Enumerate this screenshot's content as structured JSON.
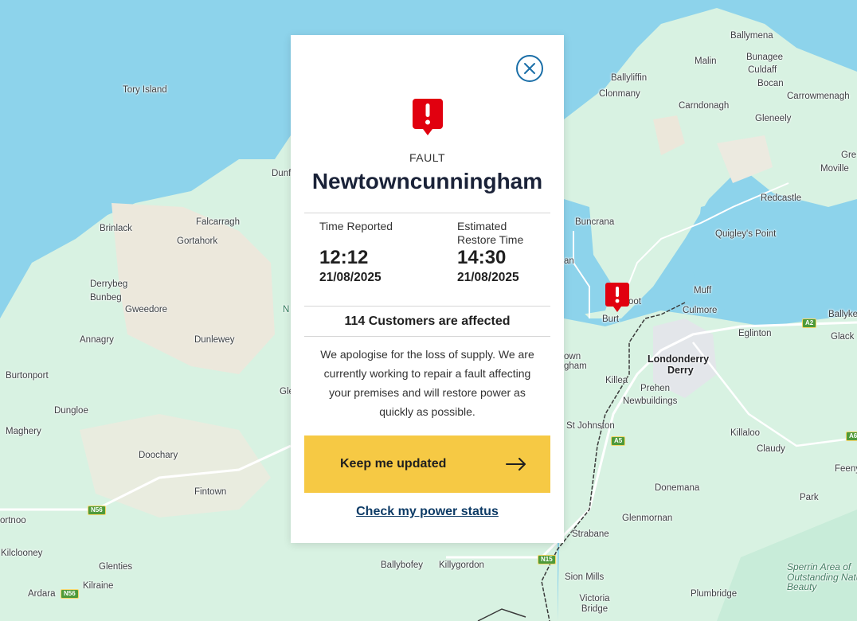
{
  "map": {
    "places": [
      {
        "id": "ballymena",
        "label": "Ballymena"
      },
      {
        "id": "malin",
        "label": "Malin"
      },
      {
        "id": "bunagee",
        "label": "Bunagee"
      },
      {
        "id": "culdaff",
        "label": "Culdaff"
      },
      {
        "id": "ballyliffin",
        "label": "Ballyliffin"
      },
      {
        "id": "bocan",
        "label": "Bocan"
      },
      {
        "id": "clonmany",
        "label": "Clonmany"
      },
      {
        "id": "carrowmenagh",
        "label": "Carrowmenagh"
      },
      {
        "id": "tory-island",
        "label": "Tory Island"
      },
      {
        "id": "carndonagh",
        "label": "Carndonagh"
      },
      {
        "id": "gleneely",
        "label": "Gleneely"
      },
      {
        "id": "gre",
        "label": "Gre"
      },
      {
        "id": "moville",
        "label": "Moville"
      },
      {
        "id": "dunf",
        "label": "Dunf"
      },
      {
        "id": "redcastle",
        "label": "Redcastle"
      },
      {
        "id": "falcarragh",
        "label": "Falcarragh"
      },
      {
        "id": "buncrana",
        "label": "Buncrana"
      },
      {
        "id": "brinlack",
        "label": "Brinlack"
      },
      {
        "id": "gortahork",
        "label": "Gortahork"
      },
      {
        "id": "quigleys-point",
        "label": "Quigley's Point"
      },
      {
        "id": "an",
        "label": "an"
      },
      {
        "id": "derrybeg",
        "label": "Derrybeg"
      },
      {
        "id": "bunbeg",
        "label": "Bunbeg"
      },
      {
        "id": "muff",
        "label": "Muff"
      },
      {
        "id": "gweedore",
        "label": "Gweedore"
      },
      {
        "id": "n-partial",
        "label": "N"
      },
      {
        "id": "burnfoot",
        "label": "oot"
      },
      {
        "id": "culmore",
        "label": "Culmore"
      },
      {
        "id": "burt",
        "label": "Burt"
      },
      {
        "id": "ballyke",
        "label": "Ballyke"
      },
      {
        "id": "annagry",
        "label": "Annagry"
      },
      {
        "id": "dunlewey",
        "label": "Dunlewey"
      },
      {
        "id": "eglinton",
        "label": "Eglinton"
      },
      {
        "id": "glack",
        "label": "Glack"
      },
      {
        "id": "own",
        "label": "own"
      },
      {
        "id": "gham",
        "label": "gham"
      },
      {
        "id": "londonderry",
        "label": "Londonderry"
      },
      {
        "id": "derry",
        "label": "Derry"
      },
      {
        "id": "burtonport",
        "label": "Burtonport"
      },
      {
        "id": "killea",
        "label": "Killea"
      },
      {
        "id": "prehen",
        "label": "Prehen"
      },
      {
        "id": "gle",
        "label": "Gle"
      },
      {
        "id": "newbuildings",
        "label": "Newbuildings"
      },
      {
        "id": "dungloe",
        "label": "Dungloe"
      },
      {
        "id": "st-johnston",
        "label": "St Johnston"
      },
      {
        "id": "killaloo",
        "label": "Killaloo"
      },
      {
        "id": "maghery",
        "label": "Maghery"
      },
      {
        "id": "claudy",
        "label": "Claudy"
      },
      {
        "id": "doochary",
        "label": "Doochary"
      },
      {
        "id": "feeny",
        "label": "Feeny"
      },
      {
        "id": "donemana",
        "label": "Donemana"
      },
      {
        "id": "fintown",
        "label": "Fintown"
      },
      {
        "id": "park",
        "label": "Park"
      },
      {
        "id": "glenmornan",
        "label": "Glenmornan"
      },
      {
        "id": "ortnoo",
        "label": "ortnoo"
      },
      {
        "id": "strabane",
        "label": "Strabane"
      },
      {
        "id": "kilclooney",
        "label": "Kilclooney"
      },
      {
        "id": "ballybofey",
        "label": "Ballybofey"
      },
      {
        "id": "killygordon",
        "label": "Killygordon"
      },
      {
        "id": "glenties",
        "label": "Glenties"
      },
      {
        "id": "sion-mills",
        "label": "Sion Mills"
      },
      {
        "id": "kilraine",
        "label": "Kilraine"
      },
      {
        "id": "ardara",
        "label": "Ardara"
      },
      {
        "id": "victoria-bridge",
        "label": "Victoria Bridge"
      },
      {
        "id": "plumbridge",
        "label": "Plumbridge"
      },
      {
        "id": "sperrin",
        "label": "Sperrin Area of Outstanding Natural Beauty"
      }
    ],
    "road_shields": [
      {
        "id": "a2",
        "label": "A2"
      },
      {
        "id": "a5",
        "label": "A5"
      },
      {
        "id": "a6",
        "label": "A6"
      },
      {
        "id": "n56-north",
        "label": "N56"
      },
      {
        "id": "n56-south",
        "label": "N56"
      },
      {
        "id": "n15",
        "label": "N15"
      }
    ],
    "water_color": "#8dd3eb",
    "land_color": "#d6f2e1",
    "pin_color": "#e1000f"
  },
  "modal": {
    "fault_type": "FAULT",
    "location": "Newtowncunningham",
    "time_reported_label": "Time Reported",
    "time_reported_value": "12:12",
    "time_reported_date": "21/08/2025",
    "restore_label_line1": "Estimated",
    "restore_label_line2": "Restore Time",
    "restore_value": "14:30",
    "restore_date": "21/08/2025",
    "affected": "114 Customers are affected",
    "apology": "We apologise for the loss of supply. We are currently working to repair a fault affecting your premises and will restore power as quickly as possible.",
    "keep_updated_label": "Keep me updated",
    "check_status_label": "Check my power status",
    "accent_color": "#f6c944",
    "link_color": "#0d3b66",
    "close_icon": "close-icon",
    "fault_icon": "fault-marker-icon",
    "arrow_icon": "arrow-right-icon"
  }
}
